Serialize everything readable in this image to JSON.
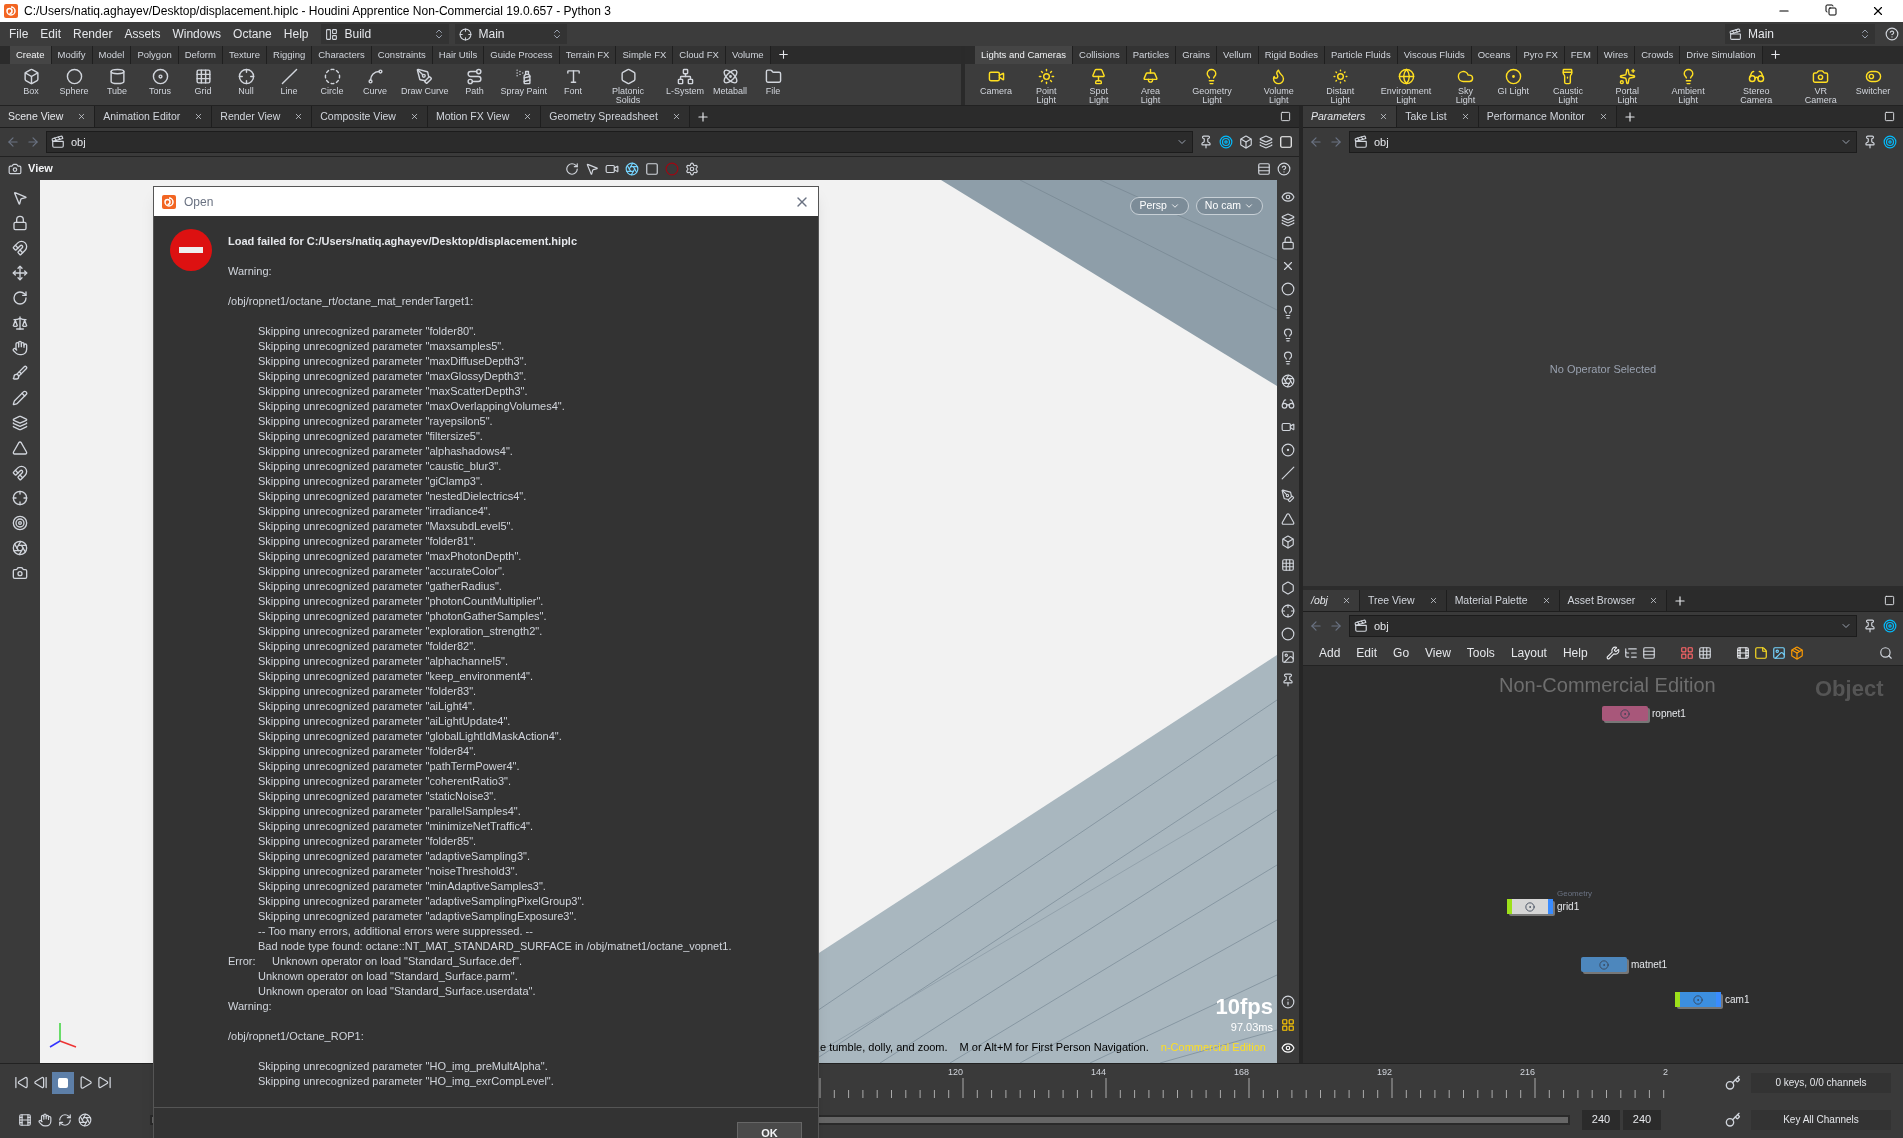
{
  "title_bar": {
    "title": "C:/Users/natiq.aghayev/Desktop/displacement.hiplc - Houdini Apprentice Non-Commercial 19.0.657 - Python 3"
  },
  "menu_bar": {
    "items": [
      "File",
      "Edit",
      "Render",
      "Assets",
      "Windows",
      "Octane",
      "Help"
    ],
    "desktop": "Build",
    "desktop_view": "Main",
    "right_desktop": "Main"
  },
  "shelves": [
    {
      "tabs": [
        {
          "label": "Create",
          "selected": true
        },
        {
          "label": "Modify",
          "selected": false
        },
        {
          "label": "Model",
          "selected": false
        },
        {
          "label": "Polygon",
          "selected": false
        },
        {
          "label": "Deform",
          "selected": false
        },
        {
          "label": "Texture",
          "selected": false
        },
        {
          "label": "Rigging",
          "selected": false
        },
        {
          "label": "Characters",
          "selected": false
        },
        {
          "label": "Constraints",
          "selected": false
        },
        {
          "label": "Hair Utils",
          "selected": false
        },
        {
          "label": "Guide Process",
          "selected": false
        },
        {
          "label": "Terrain FX",
          "selected": false
        },
        {
          "label": "Simple FX",
          "selected": false
        },
        {
          "label": "Cloud FX",
          "selected": false
        },
        {
          "label": "Volume",
          "selected": false
        }
      ],
      "tools": [
        "Box",
        "Sphere",
        "Tube",
        "Torus",
        "Grid",
        "Null",
        "Line",
        "Circle",
        "Curve",
        "Draw Curve",
        "Path",
        "Spray Paint",
        "Font",
        "Platonic Solids",
        "L-System",
        "Metaball",
        "File"
      ]
    },
    {
      "tabs": [
        {
          "label": "Lights and Cameras",
          "selected": true
        },
        {
          "label": "Collisions",
          "selected": false
        },
        {
          "label": "Particles",
          "selected": false
        },
        {
          "label": "Grains",
          "selected": false
        },
        {
          "label": "Vellum",
          "selected": false
        },
        {
          "label": "Rigid Bodies",
          "selected": false
        },
        {
          "label": "Particle Fluids",
          "selected": false
        },
        {
          "label": "Viscous Fluids",
          "selected": false
        },
        {
          "label": "Oceans",
          "selected": false
        },
        {
          "label": "Pyro FX",
          "selected": false
        },
        {
          "label": "FEM",
          "selected": false
        },
        {
          "label": "Wires",
          "selected": false
        },
        {
          "label": "Crowds",
          "selected": false
        },
        {
          "label": "Drive Simulation",
          "selected": false
        }
      ],
      "tools": [
        "Camera",
        "Point Light",
        "Spot Light",
        "Area Light",
        "Geometry Light",
        "Volume Light",
        "Distant Light",
        "Environment Light",
        "Sky Light",
        "GI Light",
        "Caustic Light",
        "Portal Light",
        "Ambient Light",
        "Stereo Camera",
        "VR Camera",
        "Switcher"
      ]
    }
  ],
  "scene_pane": {
    "tabs": [
      {
        "label": "Scene View",
        "selected": true
      },
      {
        "label": "Animation Editor",
        "selected": false
      },
      {
        "label": "Render View",
        "selected": false
      },
      {
        "label": "Composite View",
        "selected": false
      },
      {
        "label": "Motion FX View",
        "selected": false
      },
      {
        "label": "Geometry Spreadsheet",
        "selected": false
      }
    ],
    "path": "obj",
    "header": "View",
    "viewport": {
      "camera_menus": [
        "Persp",
        "No cam"
      ],
      "fps": "10fps",
      "frame_time": "97.03ms",
      "status_hints": [
        "e tumble, dolly, and zoom.",
        "M or Alt+M for First Person Navigation."
      ],
      "edition_note": "n-Commercial Edition"
    }
  },
  "parameters_pane": {
    "tabs": [
      {
        "label": "Parameters",
        "selected": true
      },
      {
        "label": "Take List",
        "selected": false
      },
      {
        "label": "Performance Monitor",
        "selected": false
      }
    ],
    "path": "obj",
    "message": "No Operator Selected"
  },
  "network_pane": {
    "tabs": [
      {
        "label": "/obj",
        "selected": true
      },
      {
        "label": "Tree View",
        "selected": false
      },
      {
        "label": "Material Palette",
        "selected": false
      },
      {
        "label": "Asset Browser",
        "selected": false
      }
    ],
    "path": "obj",
    "menu": [
      "Add",
      "Edit",
      "Go",
      "View",
      "Tools",
      "Layout",
      "Help"
    ],
    "watermark": "Non-Commercial Edition",
    "context_label": "Object",
    "nodes": [
      {
        "name": "ropnet1",
        "color": "#a8577a",
        "flags": false
      },
      {
        "name": "grid1",
        "type_label": "Geometry",
        "color": "#d6d6d6",
        "flags": true
      },
      {
        "name": "matnet1",
        "color": "#4d87bd",
        "flags": false
      },
      {
        "name": "cam1",
        "color": "#3c8fe0",
        "flags": true
      }
    ]
  },
  "dialog": {
    "title": "Open",
    "heading": "Load failed for C:/Users/natiq.aghayev/Desktop/displacement.hiplc",
    "button": "OK",
    "paragraphs": [
      [
        {
          "kind": "plain",
          "lines": [
            "Warning:"
          ]
        }
      ],
      [
        {
          "kind": "plain",
          "lines": [
            "/obj/ropnet1/octane_rt/octane_mat_renderTarget1:"
          ]
        }
      ],
      [
        {
          "kind": "indented",
          "lines": [
            "Skipping unrecognized parameter \"folder80\".",
            "Skipping unrecognized parameter \"maxsamples5\".",
            "Skipping unrecognized parameter \"maxDiffuseDepth3\".",
            "Skipping unrecognized parameter \"maxGlossyDepth3\".",
            "Skipping unrecognized parameter \"maxScatterDepth3\".",
            "Skipping unrecognized parameter \"maxOverlappingVolumes4\".",
            "Skipping unrecognized parameter \"rayepsilon5\".",
            "Skipping unrecognized parameter \"filtersize5\".",
            "Skipping unrecognized parameter \"alphashadows4\".",
            "Skipping unrecognized parameter \"caustic_blur3\".",
            "Skipping unrecognized parameter \"giClamp3\".",
            "Skipping unrecognized parameter \"nestedDielectrics4\".",
            "Skipping unrecognized parameter \"irradiance4\".",
            "Skipping unrecognized parameter \"MaxsubdLevel5\".",
            "Skipping unrecognized parameter \"folder81\".",
            "Skipping unrecognized parameter \"maxPhotonDepth\".",
            "Skipping unrecognized parameter \"accurateColor\".",
            "Skipping unrecognized parameter \"gatherRadius\".",
            "Skipping unrecognized parameter \"photonCountMultiplier\".",
            "Skipping unrecognized parameter \"photonGatherSamples\".",
            "Skipping unrecognized parameter \"exploration_strength2\".",
            "Skipping unrecognized parameter \"folder82\".",
            "Skipping unrecognized parameter \"alphachannel5\".",
            "Skipping unrecognized parameter \"keep_environment4\".",
            "Skipping unrecognized parameter \"folder83\".",
            "Skipping unrecognized parameter \"aiLight4\".",
            "Skipping unrecognized parameter \"aiLightUpdate4\".",
            "Skipping unrecognized parameter \"globalLightIdMaskAction4\".",
            "Skipping unrecognized parameter \"folder84\".",
            "Skipping unrecognized parameter \"pathTermPower4\".",
            "Skipping unrecognized parameter \"coherentRatio3\".",
            "Skipping unrecognized parameter \"staticNoise3\".",
            "Skipping unrecognized parameter \"parallelSamples4\".",
            "Skipping unrecognized parameter \"minimizeNetTraffic4\".",
            "Skipping unrecognized parameter \"folder85\".",
            "Skipping unrecognized parameter \"adaptiveSampling3\".",
            "Skipping unrecognized parameter \"noiseThreshold3\".",
            "Skipping unrecognized parameter \"minAdaptiveSamples3\".",
            "Skipping unrecognized parameter \"adaptiveSamplingPixelGroup3\".",
            "Skipping unrecognized parameter \"adaptiveSamplingExposure3\".",
            "-- Too many errors, additional errors were suppressed. --",
            "Bad node type found: octane::NT_MAT_STANDARD_SURFACE in /obj/matnet1/octane_vopnet1."
          ]
        },
        {
          "kind": "error",
          "label": "Error:",
          "lines": [
            "Unknown operator on load \"Standard_Surface.def\".",
            "Unknown operator on load \"Standard_Surface.parm\".",
            "Unknown operator on load \"Standard_Surface.userdata\"."
          ]
        },
        {
          "kind": "plain",
          "lines": [
            "Warning:"
          ]
        }
      ],
      [
        {
          "kind": "plain",
          "lines": [
            "/obj/ropnet1/Octane_ROP1:"
          ]
        }
      ],
      [
        {
          "kind": "indented",
          "lines": [
            "Skipping unrecognized parameter \"HO_img_preMultAlpha\".",
            "Skipping unrecognized parameter \"HO_img_exrCompLevel\"."
          ]
        }
      ]
    ]
  },
  "timeline": {
    "stopped": true,
    "ticks": [
      "120",
      "144",
      "168",
      "192",
      "216",
      "2"
    ],
    "range": {
      "level": 1
    },
    "range_end_fields": [
      "240",
      "240"
    ],
    "keys_status": "0 keys, 0/0 channels",
    "key_button": "Key All Channels"
  }
}
